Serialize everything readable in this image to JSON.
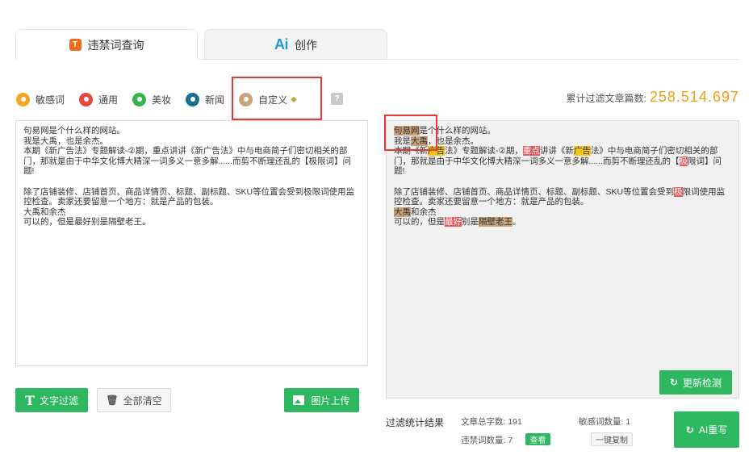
{
  "tabs": [
    {
      "icon": "T",
      "label": "违禁词查询"
    },
    {
      "icon": "Ai",
      "label": "创作"
    }
  ],
  "categories": [
    {
      "label": "敏感词",
      "color": "#f5a623"
    },
    {
      "label": "通用",
      "color": "#e8473b"
    },
    {
      "label": "美妆",
      "color": "#37b24d"
    },
    {
      "label": "新闻",
      "color": "#1b6f8f"
    },
    {
      "label": "自定义",
      "color": "#c9a27c"
    }
  ],
  "help_label": "?",
  "counter": {
    "label": "累计过滤文章篇数:",
    "value": "258.514.697"
  },
  "input_lines": [
    "句易网是个什么样的网站。",
    "我是大禹，也是余杰。",
    "本期《新广告法》专题解读-②期，重点讲讲《新广告法》中与电商简子们密切相关的部",
    "门，那就是由于中华文化博大精深一词多义一意多解......而剪不断理还乱的【极限词】问",
    "题!",
    "",
    "除了店铺装修、店铺首页、商品详情页、标题、副标题、SKU等位置会受到极限词使用监",
    "控检查。卖家还要留意一个地方：就是产品的包装。",
    "大禹和余杰",
    "可以的，但是最好别是隔壁老王。"
  ],
  "output_lines": [
    [
      {
        "t": "句易网",
        "h": "c"
      },
      {
        "t": "是个什么样的网站。"
      }
    ],
    [
      {
        "t": "我是"
      },
      {
        "t": "大禹",
        "h": "c"
      },
      {
        "t": "，也是余杰。"
      }
    ],
    [
      {
        "t": "本期《新"
      },
      {
        "t": "广告",
        "h": "y"
      },
      {
        "t": "法》专题解读-②期，"
      },
      {
        "t": "重点",
        "h": "r"
      },
      {
        "t": "讲讲《新"
      },
      {
        "t": "广告",
        "h": "y"
      },
      {
        "t": "法》中与电商简子们密切相关的部"
      }
    ],
    [
      {
        "t": "门，那就是由于中华文化博大精深一词多义一意多解......而剪不断理还乱的【"
      },
      {
        "t": "极",
        "h": "r"
      },
      {
        "t": "限词】问"
      }
    ],
    [
      {
        "t": "题!"
      }
    ],
    [],
    [
      {
        "t": "除了店铺装修、店铺首页、商品详情页、标题、副标题、SKU等位置会受到"
      },
      {
        "t": "极",
        "h": "r"
      },
      {
        "t": "限词使用监"
      }
    ],
    [
      {
        "t": "控检查。卖家还要留意一个地方：就是产品的包装。"
      }
    ],
    [
      {
        "t": "大禹",
        "h": "c"
      },
      {
        "t": "和余杰"
      }
    ],
    [
      {
        "t": "可以的，但是"
      },
      {
        "t": "最好",
        "h": "r"
      },
      {
        "t": "别是"
      },
      {
        "t": "隔壁老王",
        "h": "c"
      },
      {
        "t": "。"
      }
    ]
  ],
  "buttons": {
    "filter": "文字过滤",
    "clear": "全部清空",
    "upload": "图片上传",
    "recheck": "更新检测",
    "ai_rewrite": "AI重写",
    "copy": "一键复制",
    "view": "查看"
  },
  "stats": {
    "title": "过滤统计结果",
    "total_words": "文章总字数: 191",
    "sensitive_count": "敏感词数量: 1",
    "banned_count": "违禁词数量: 7"
  }
}
